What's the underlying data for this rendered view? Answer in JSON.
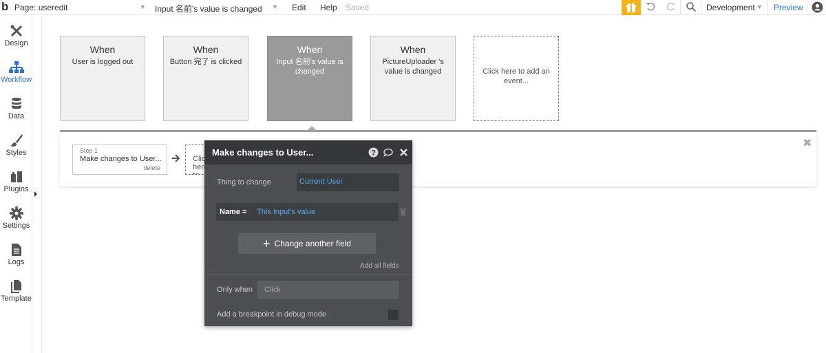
{
  "topbar": {
    "logo": "b",
    "page_label": "Page: useredit",
    "element_label": "Input 名前's value is changed",
    "menu": {
      "edit": "Edit",
      "help": "Help",
      "saved": "Saved"
    },
    "environment": "Development",
    "preview": "Preview"
  },
  "sidebar": {
    "items": [
      {
        "label": "Design",
        "icon": "design-icon"
      },
      {
        "label": "Workflow",
        "icon": "workflow-icon"
      },
      {
        "label": "Data",
        "icon": "database-icon"
      },
      {
        "label": "Styles",
        "icon": "brush-icon"
      },
      {
        "label": "Plugins",
        "icon": "plugin-icon"
      },
      {
        "label": "Settings",
        "icon": "gear-icon"
      },
      {
        "label": "Logs",
        "icon": "document-icon"
      },
      {
        "label": "Template",
        "icon": "template-icon"
      }
    ],
    "active": "Workflow"
  },
  "events": [
    {
      "when": "When",
      "desc": "User is logged out"
    },
    {
      "when": "When",
      "desc": "Button 完了 is clicked"
    },
    {
      "when": "When",
      "desc": "Input 名前's value is changed"
    },
    {
      "when": "When",
      "desc": "PictureUploader 's value is changed"
    }
  ],
  "add_event": "Click here to add an event...",
  "step": {
    "label": "Step 1",
    "action": "Make changes to User...",
    "delete": "delete"
  },
  "next_step": "Click here to add an action...",
  "editor": {
    "title": "Make changes to User...",
    "thing_label": "Thing to change",
    "thing_value": "Current User",
    "name_label": "Name =",
    "name_value": "This Input's value",
    "change_button": "Change another field",
    "add_all": "Add all fields",
    "only_when_label": "Only when",
    "only_when_value": "Click",
    "breakpoint_label": "Add a breakpoint in debug mode"
  },
  "colors": {
    "accent": "#2d6fd6",
    "gift": "#f7b21a",
    "editor_bg": "#4b4f52",
    "link": "#5aa7f0"
  }
}
